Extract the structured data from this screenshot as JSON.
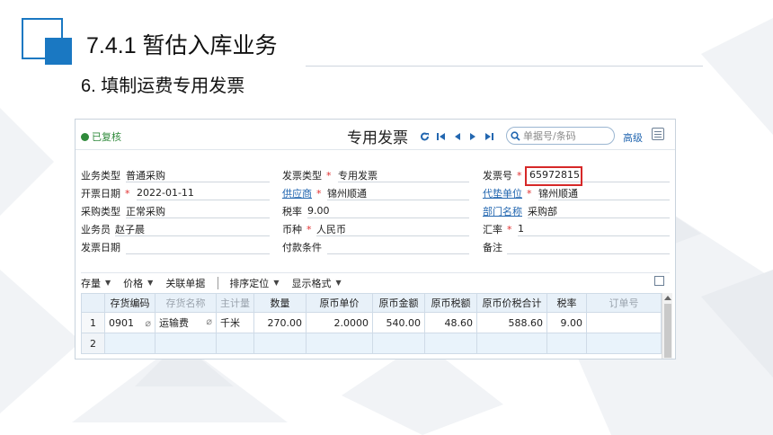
{
  "slide": {
    "title": "7.4.1  暂估入库业务",
    "subtitle": "6. 填制运费专用发票"
  },
  "header": {
    "status": "已复核",
    "doc_title": "专用发票",
    "search_placeholder": "单据号/条码",
    "advanced_label": "高级"
  },
  "form": {
    "business_type_label": "业务类型",
    "business_type_value": "普通采购",
    "invoice_type_label": "发票类型",
    "invoice_type_value": "专用发票",
    "invoice_no_label": "发票号",
    "invoice_no_value": "65972815",
    "issue_date_label": "开票日期",
    "issue_date_value": "2022-01-11",
    "supplier_label": "供应商",
    "supplier_value": "锦州顺通",
    "payer_label": "代垫单位",
    "payer_value": "锦州顺通",
    "purchase_type_label": "采购类型",
    "purchase_type_value": "正常采购",
    "tax_rate_label": "税率",
    "tax_rate_value": "9.00",
    "dept_label": "部门名称",
    "dept_value": "采购部",
    "clerk_label": "业务员",
    "clerk_value": "赵子晨",
    "currency_label": "币种",
    "currency_value": "人民币",
    "exchange_label": "汇率",
    "exchange_value": "1",
    "invoice_date_label": "发票日期",
    "payment_terms_label": "付款条件",
    "remark_label": "备注"
  },
  "toolbar": {
    "stock": "存量",
    "price": "价格",
    "link_docs": "关联单据",
    "sort": "排序定位",
    "display": "显示格式"
  },
  "grid": {
    "headers": [
      "存货编码",
      "存货名称",
      "主计量",
      "数量",
      "原币单价",
      "原币金额",
      "原币税额",
      "原币价税合计",
      "税率",
      "订单号"
    ],
    "rows": [
      {
        "no": "1",
        "code": "0901",
        "name": "运输费",
        "unit": "千米",
        "qty": "270.00",
        "price": "2.0000",
        "amount": "540.00",
        "tax": "48.60",
        "total": "588.60",
        "rate": "9.00",
        "order": ""
      },
      {
        "no": "2"
      }
    ]
  },
  "colors": {
    "accent": "#1a78c2",
    "status_green": "#2f8a3b",
    "highlight_red": "#d62828",
    "link_blue": "#2367b0"
  }
}
